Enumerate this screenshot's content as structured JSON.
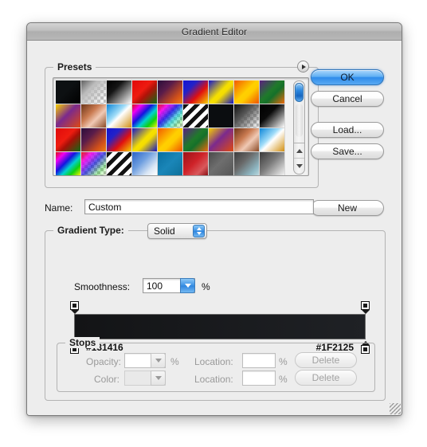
{
  "window": {
    "title": "Gradient Editor"
  },
  "presets": {
    "legend": "Presets",
    "menu_icon": "triangle-right-icon",
    "swatches": [
      {
        "name": "black-transparent",
        "css": "linear-gradient(135deg, #0d1012 0%, #0d1012 45%, #000000 100%)"
      },
      {
        "name": "white-to-transparent",
        "checker": true,
        "css": "linear-gradient(135deg, #606060 0%, #bdbdbd 35%, rgba(255,255,255,0.05) 100%)"
      },
      {
        "name": "black-to-white",
        "css": "linear-gradient(135deg, #000000 0%, #151515 35%, #ffffff 100%)"
      },
      {
        "name": "red-green",
        "css": "linear-gradient(135deg, #e2070a 0%, #ee1b10 42%, #b31208 58%, #0b6b15 100%)"
      },
      {
        "name": "violet-orange",
        "css": "linear-gradient(135deg, #2a0d3a 0%, #5a1c4a 35%, #d1501a 75%, #f07f10 100%)"
      },
      {
        "name": "blue-red-yellow",
        "css": "linear-gradient(135deg, #1414d2 0%, #2222c8 30%, #e01010 62%, #f5d200 100%)"
      },
      {
        "name": "blue-yellow-blue",
        "css": "linear-gradient(135deg, #1414cc 0%, #f5e000 48%, #f5dd00 58%, #1313c4 100%)"
      },
      {
        "name": "orange-yellow-orange",
        "css": "linear-gradient(135deg, #f25a00 0%, #ffd000 48%, #ffcc00 60%, #ef5200 100%)"
      },
      {
        "name": "violet-green-orange",
        "css": "linear-gradient(135deg, #5c2080 0%, #1f7a2a 45%, #15702a 60%, #ef6a0c 100%)"
      },
      {
        "name": "yellow-violet-orange",
        "css": "linear-gradient(135deg, #f7d000 0%, #7b2a8d 45%, #e04a10 100%)"
      },
      {
        "name": "copper",
        "css": "linear-gradient(135deg, #6b3418 0%, #c97a50 38%, #f0c9b4 62%, #8a4a26 100%)"
      },
      {
        "name": "blue-white-orange",
        "css": "linear-gradient(135deg, #0d86d8 0%, #9fdcf8 40%, #ffffff 52%, #d28f12 100%)"
      },
      {
        "name": "spectrum",
        "css": "linear-gradient(135deg, #e01010 0%, #f000f0 20%, #1414e0 42%, #00d0d0 60%, #10d010 78%, #f5f500 100%)"
      },
      {
        "name": "transparent-rainbow",
        "checker": true,
        "css": "linear-gradient(135deg, rgba(224,16,16,0.95) 0%, rgba(240,0,240,0.9) 22%, rgba(20,20,224,0.85) 45%, rgba(0,208,208,0.6) 65%, rgba(16,208,16,0.3) 85%, rgba(245,245,0,0.05) 100%)"
      },
      {
        "name": "black-white-stripes",
        "css": "repeating-linear-gradient(135deg, #111111 0 5px, #ffffff 5px 10px)"
      },
      {
        "name": "solid-black",
        "css": "linear-gradient(135deg, #0b0d10 0%, #0b0d10 100%)"
      },
      {
        "name": "black-to-transparent-checker",
        "checker": true,
        "css": "linear-gradient(135deg, #111111 0%, #555555 40%, rgba(255,255,255,0.05) 100%)"
      },
      {
        "name": "black-white-diagonal",
        "css": "linear-gradient(135deg, #000000 0%, #0a0a0a 40%, #ffffff 100%)"
      },
      {
        "name": "red-green-2",
        "css": "linear-gradient(135deg, #e00a0a 0%, #ee1c10 42%, #a81007 58%, #0d6d15 100%)"
      },
      {
        "name": "violet-orange-2",
        "css": "linear-gradient(135deg, #2a0d3a 0%, #5a1c4a 35%, #d1501a 75%, #f07f10 100%)"
      },
      {
        "name": "blue-red-yellow-2",
        "css": "linear-gradient(135deg, #1414d2 0%, #2222c8 30%, #e01010 62%, #f5d200 100%)"
      },
      {
        "name": "blue-yellow-blue-2",
        "css": "linear-gradient(135deg, #1414cc 0%, #f5e000 48%, #f5dd00 58%, #1313c4 100%)"
      },
      {
        "name": "orange-yellow-2",
        "css": "linear-gradient(135deg, #f25a00 0%, #ffd000 48%, #ffcc00 60%, #ef5200 100%)"
      },
      {
        "name": "violet-green-orange-2",
        "css": "linear-gradient(135deg, #5c2080 0%, #1f7a2a 45%, #15702a 60%, #ef6a0c 100%)"
      },
      {
        "name": "yellow-violet-orange-2",
        "css": "linear-gradient(135deg, #f7d000 0%, #7b2a8d 45%, #e04a10 100%)"
      },
      {
        "name": "copper-2",
        "css": "linear-gradient(135deg, #6b3418 0%, #c97a50 38%, #f0c9b4 62%, #8a4a26 100%)"
      },
      {
        "name": "blue-white-orange-2",
        "css": "linear-gradient(135deg, #0d86d8 0%, #9fdcf8 40%, #ffffff 52%, #d28f12 100%)"
      },
      {
        "name": "spectrum-2",
        "css": "linear-gradient(135deg, #e01010 0%, #f000f0 20%, #1414e0 42%, #00d0d0 60%, #10d010 78%, #f5f500 100%)"
      },
      {
        "name": "transparent-rainbow-2",
        "checker": true,
        "css": "linear-gradient(135deg, rgba(224,16,16,0.95) 0%, rgba(240,0,240,0.85) 25%, rgba(20,20,224,0.7) 50%, rgba(16,208,16,0.35) 78%, rgba(245,245,0,0.05) 100%)"
      },
      {
        "name": "black-white-stripes-2",
        "css": "repeating-linear-gradient(135deg, #111111 0 5px, #ffffff 5px 10px)"
      },
      {
        "name": "blue-white",
        "css": "linear-gradient(135deg, #2a63c8 0%, #6f9fe0 40%, #dbe7f5 75%, #ffffff 100%)"
      },
      {
        "name": "teal-solid",
        "css": "linear-gradient(135deg, #0a6ea0 0%, #1a86b8 50%, #0e7099 100%)"
      },
      {
        "name": "red-dark-red",
        "css": "linear-gradient(135deg, #9a1218 0%, #cf2228 45%, #d8595c 75%, #8b1015 100%)"
      },
      {
        "name": "gray-steel",
        "css": "linear-gradient(135deg, #4a4a4a 0%, #6e6e6e 45%, #565656 100%)"
      },
      {
        "name": "gray-cyan",
        "css": "linear-gradient(135deg, #3c3c3c 0%, #6a6a6a 40%, #8fb8c4 80%, #b9d6dd 100%)"
      },
      {
        "name": "gray-white",
        "css": "linear-gradient(135deg, #3a3a3a 0%, #7a7a7a 45%, #c8c8c8 80%, #f0f0f0 100%)"
      }
    ]
  },
  "buttons": {
    "ok": "OK",
    "cancel": "Cancel",
    "load": "Load...",
    "save": "Save...",
    "new": "New"
  },
  "name_row": {
    "label": "Name:",
    "value": "Custom"
  },
  "gradient_type": {
    "legend": "Gradient Type:",
    "value": "Solid"
  },
  "smoothness": {
    "label": "Smoothness:",
    "value": "100",
    "unit": "%"
  },
  "gradient": {
    "start_hex": "#131416",
    "end_hex": "#1F2125",
    "bar_css": "linear-gradient(to right, #131416 0%, #1F2125 100%)"
  },
  "stops": {
    "legend": "Stops",
    "opacity_label": "Opacity:",
    "opacity_value": "",
    "opacity_unit": "%",
    "location1_label": "Location:",
    "location1_value": "",
    "location1_unit": "%",
    "delete1": "Delete",
    "color_label": "Color:",
    "location2_label": "Location:",
    "location2_value": "",
    "location2_unit": "%",
    "delete2": "Delete"
  }
}
